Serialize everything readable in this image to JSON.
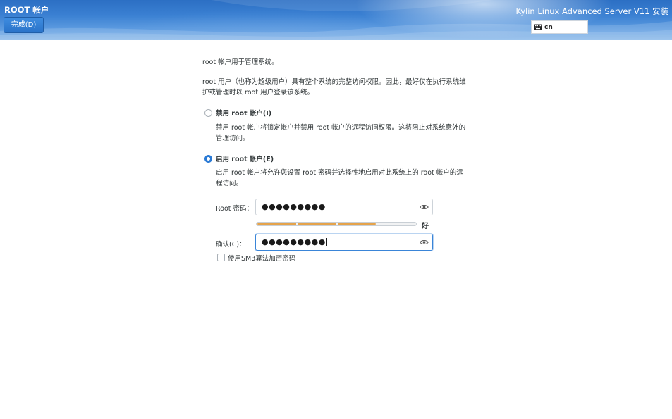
{
  "header": {
    "screen_title": "ROOT 帐户",
    "done_button_label": "完成(D)",
    "product_title": "Kylin Linux Advanced Server V11 安装",
    "keyboard_layout": "cn",
    "keyboard_icon": "keyboard-icon"
  },
  "intro": {
    "line1": "root 帐户用于管理系统。",
    "line2a": "root 用户（也称为超级用户）具有整个系统的完整访问权限。因此，最好仅在执行系统维",
    "line2b": "护或管理时以 root 用户登录该系统。"
  },
  "options": {
    "disable": {
      "label": "禁用 root 帐户(I)",
      "desc_a": "禁用 root 帐户将锁定帐户并禁用 root 帐户的远程访问权限。这将阻止对系统意外的",
      "desc_b": "管理访问。",
      "selected": false
    },
    "enable": {
      "label": "启用 root 帐户(E)",
      "desc_a": "启用 root 帐户将允许您设置 root 密码并选择性地启用对此系统上的 root 帐户的远",
      "desc_b": "程访问。",
      "selected": true
    }
  },
  "password": {
    "label": "Root 密码：",
    "masked_value": "●●●●●●●●●",
    "reveal_icon": "eye-icon"
  },
  "strength": {
    "fraction": 0.75,
    "label": "好",
    "color": "#e5a34b"
  },
  "confirm": {
    "label": "确认(C)：",
    "masked_value": "●●●●●●●●●",
    "reveal_icon": "eye-icon"
  },
  "sm3": {
    "label": "使用SM3算法加密密码",
    "checked": false
  },
  "colors": {
    "accent": "#2a7ad5",
    "header_top": "#2c6fc4",
    "header_bottom": "#7eb2e8"
  }
}
